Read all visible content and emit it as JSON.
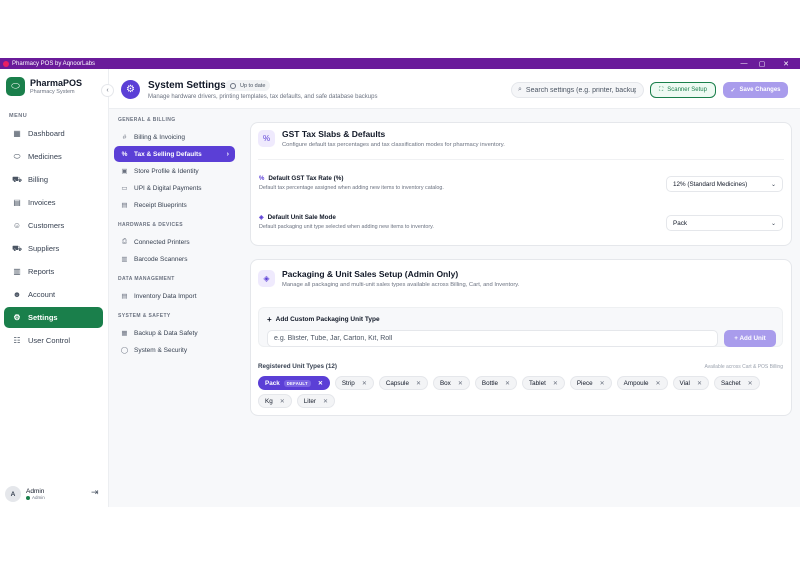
{
  "window": {
    "title": "Pharmacy POS by AqnoorLabs",
    "controls": [
      "—",
      "▢",
      "✕"
    ]
  },
  "sidebar": {
    "brand_name": "PharmaPOS",
    "brand_sub": "Pharmacy System",
    "collapse_icon": "chevron-left-icon",
    "menu_label": "MENU",
    "items": [
      {
        "label": "Dashboard",
        "icon": "grid-icon",
        "active": false
      },
      {
        "label": "Medicines",
        "icon": "pill-icon",
        "active": false
      },
      {
        "label": "Billing",
        "icon": "cart-icon",
        "active": false
      },
      {
        "label": "Invoices",
        "icon": "document-icon",
        "active": false
      },
      {
        "label": "Customers",
        "icon": "users-icon",
        "active": false
      },
      {
        "label": "Suppliers",
        "icon": "truck-icon",
        "active": false
      },
      {
        "label": "Reports",
        "icon": "chart-icon",
        "active": false
      },
      {
        "label": "Account",
        "icon": "user-icon",
        "active": false
      },
      {
        "label": "Settings",
        "icon": "gear-icon",
        "active": true
      },
      {
        "label": "User Control",
        "icon": "user-group-icon",
        "active": false
      }
    ],
    "user": {
      "avatar": "A",
      "name": "Admin",
      "role": "Admin"
    }
  },
  "header": {
    "title": "System Settings",
    "status": "Up to date",
    "subtitle": "Manage hardware drivers, printing templates, tax defaults, and safe database backups",
    "search_placeholder": "Search settings (e.g. printer, backup)",
    "scanner_label": "Scanner Setup",
    "save_label": "Save Changes"
  },
  "subnav": {
    "groups": [
      {
        "label": "GENERAL & BILLING",
        "items": [
          {
            "label": "Billing & Invoicing",
            "icon": "#",
            "active": false
          },
          {
            "label": "Tax & Selling Defaults",
            "icon": "%",
            "active": true
          },
          {
            "label": "Store Profile & Identity",
            "icon": "▣",
            "active": false
          },
          {
            "label": "UPI & Digital Payments",
            "icon": "▭",
            "active": false
          },
          {
            "label": "Receipt Blueprints",
            "icon": "▤",
            "active": false
          }
        ]
      },
      {
        "label": "HARDWARE & DEVICES",
        "items": [
          {
            "label": "Connected Printers",
            "icon": "⎙",
            "active": false
          },
          {
            "label": "Barcode Scanners",
            "icon": "▥",
            "active": false
          }
        ]
      },
      {
        "label": "DATA MANAGEMENT",
        "items": [
          {
            "label": "Inventory Data Import",
            "icon": "▤",
            "active": false
          }
        ]
      },
      {
        "label": "SYSTEM & SAFETY",
        "items": [
          {
            "label": "Backup & Data Safety",
            "icon": "▦",
            "active": false
          },
          {
            "label": "System & Security",
            "icon": "◯",
            "active": false
          }
        ]
      }
    ]
  },
  "gst_card": {
    "title": "GST Tax Slabs & Defaults",
    "subtitle": "Configure default tax percentages and tax classification modes for pharmacy inventory.",
    "rate_label": "Default GST Tax Rate (%)",
    "rate_desc": "Default tax percentage assigned when adding new items to inventory catalog.",
    "rate_value": "12% (Standard Medicines)",
    "mode_label": "Default Unit Sale Mode",
    "mode_desc": "Default packaging unit type selected when adding new items to inventory.",
    "mode_value": "Pack"
  },
  "packaging_card": {
    "title": "Packaging & Unit Sales Setup (Admin Only)",
    "subtitle": "Manage all packaging and multi-unit sales types available across Billing, Cart, and Inventory.",
    "add_title": "Add Custom Packaging Unit Type",
    "input_placeholder": "e.g. Blister, Tube, Jar, Carton, Kit, Roll",
    "add_button": "+ Add Unit",
    "registered_label": "Registered Unit Types (12)",
    "hint": "Available across Cart & POS Billing",
    "default_tag": "DEFAULT",
    "units": [
      "Pack",
      "Strip",
      "Capsule",
      "Box",
      "Bottle",
      "Tablet",
      "Piece",
      "Ampoule",
      "Vial",
      "Sachet",
      "Kg",
      "Liter"
    ]
  },
  "colors": {
    "titlebar": "#6a1b9a",
    "brand_green": "#1a7f4b",
    "accent_purple": "#5b3fd6",
    "disabled_purple": "#a99cec"
  }
}
